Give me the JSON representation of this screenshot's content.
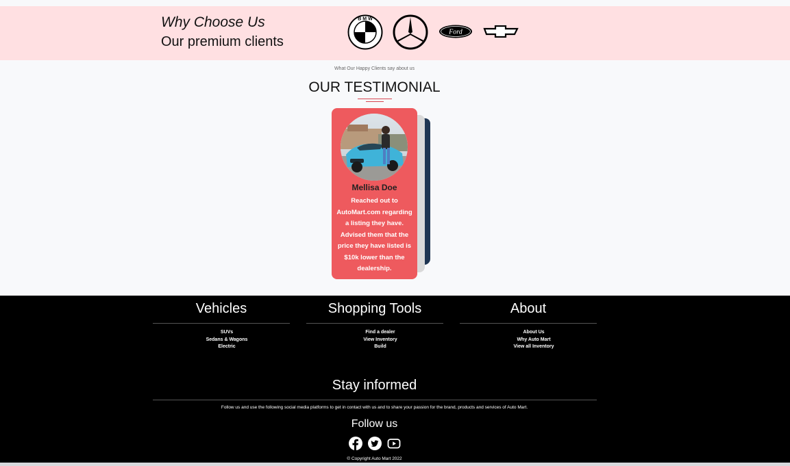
{
  "clients": {
    "title": "Why Choose Us",
    "subtitle": "Our premium clients",
    "logos": [
      "bmw-logo",
      "mercedes-logo",
      "ford-logo",
      "chevrolet-logo"
    ],
    "ford_text": "Ford",
    "bmw_text": "B M W"
  },
  "testimonial": {
    "kicker": "What Our Happy Clients say about us",
    "title": "OUR TESTIMONIAL",
    "card": {
      "name": "Mellisa Doe",
      "text": "Reached out to AutoMart.com regarding a listing they have. Advised them that the price they have listed is $10k lower than the dealership."
    }
  },
  "footer": {
    "columns": [
      {
        "title": "Vehicles",
        "links": [
          "SUVs",
          "Sedans & Wagons",
          "Electric"
        ]
      },
      {
        "title": "Shopping Tools",
        "links": [
          "Find a dealer",
          "View Inventory",
          "Build"
        ]
      },
      {
        "title": "About",
        "links": [
          "About Us",
          "Why Auto Mart",
          "View all Inventory"
        ]
      }
    ],
    "stay_title": "Stay informed",
    "stay_text": "Follow us and use the following social media platforms to get in contact with us and to share your passion for the brand, products and services of Auto Mart.",
    "follow_title": "Follow us",
    "social": [
      "facebook-icon",
      "twitter-icon",
      "youtube-icon"
    ],
    "copyright": "© Copyright Auto Mart 2022"
  },
  "colors": {
    "clients_bg": "#ffe0e2",
    "card_red": "#ee5a5e",
    "card_back_navy": "#1e3552",
    "accent_line": "#d64550",
    "footer_bg": "#000000"
  }
}
